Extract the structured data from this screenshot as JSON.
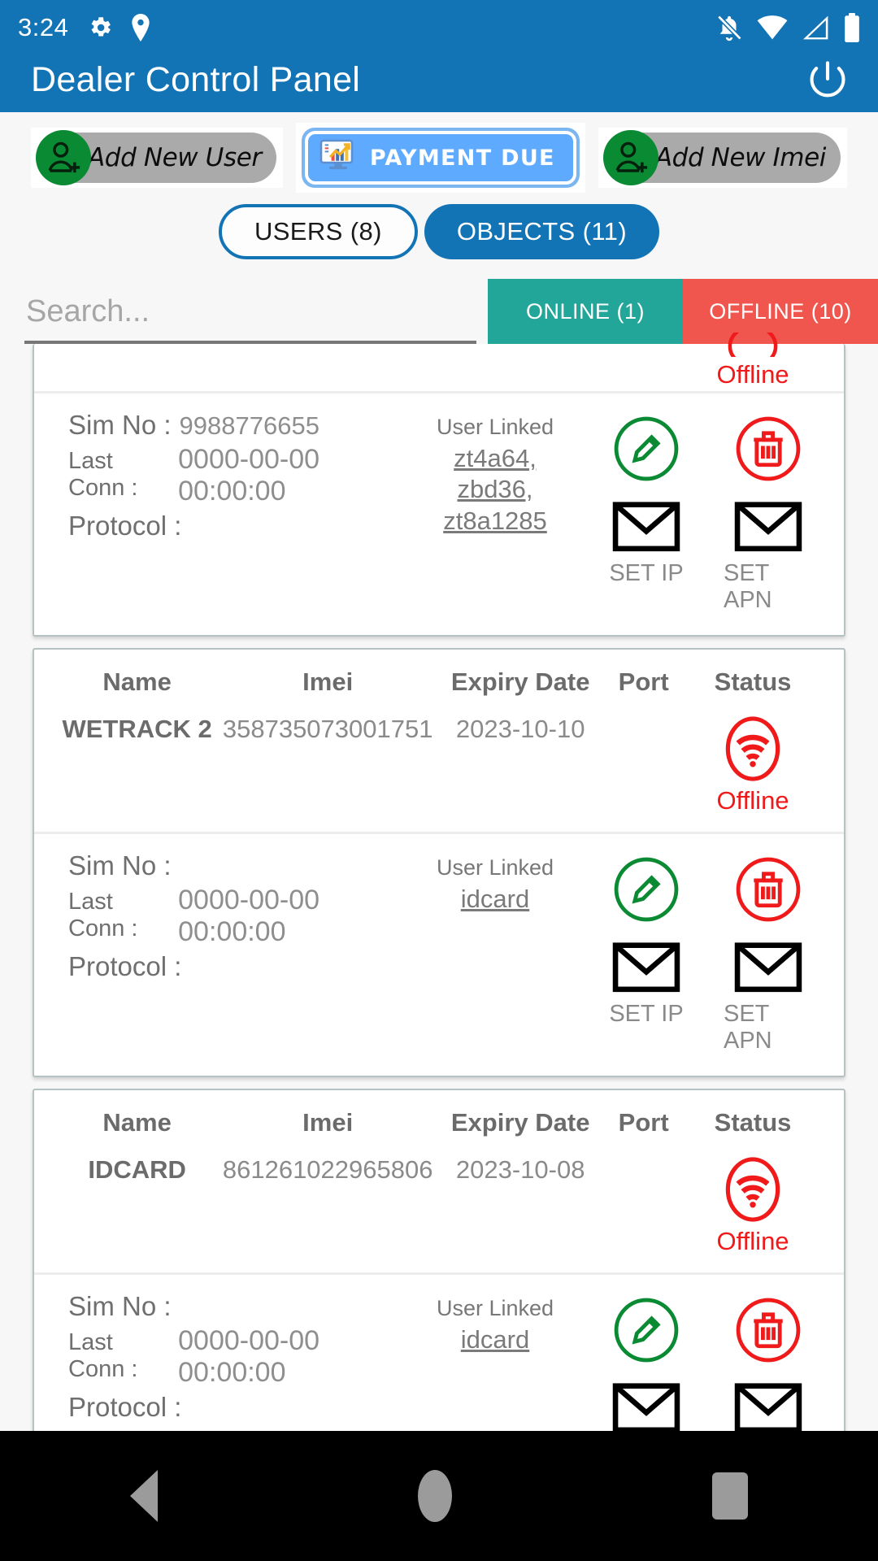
{
  "status_bar": {
    "time": "3:24",
    "left_icons": [
      "gear-icon",
      "location-pin-icon"
    ],
    "right_icons": [
      "notifications-off-icon",
      "wifi-icon",
      "signal-icon",
      "battery-icon"
    ]
  },
  "app_bar": {
    "title": "Dealer Control Panel",
    "power_icon": "power-icon"
  },
  "actions": {
    "add_user_label": "Add New User",
    "payment_due_label": "PAYMENT DUE",
    "add_imei_label": "Add  New Imei"
  },
  "tabs": {
    "users_label": "USERS (8)",
    "objects_label": "OBJECTS (11)",
    "selected": "OBJECTS (11)"
  },
  "search": {
    "value": "",
    "placeholder": "Search..."
  },
  "filters": {
    "online_label": "ONLINE (1)",
    "offline_label": "OFFLINE (10)"
  },
  "table_headers": {
    "name": "Name",
    "imei": "Imei",
    "expiry": "Expiry Date",
    "port": "Port",
    "status": "Status"
  },
  "detail_labels": {
    "sim_no": "Sim No :",
    "last_conn": "Last Conn :",
    "protocol": "Protocol :",
    "user_linked": "User Linked",
    "set_ip": "SET IP",
    "set_apn": "SET APN"
  },
  "cards": [
    {
      "clipped": true,
      "status_text": "Offline",
      "sim_no": "9988776655",
      "last_conn": "0000-00-00 00:00:00",
      "protocol": "",
      "linked_users": [
        "zt4a64,",
        "zbd36,",
        "zt8a1285"
      ]
    },
    {
      "clipped": false,
      "name": "WETRACK 2",
      "imei": "358735073001751",
      "expiry": "2023-10-10",
      "port": "",
      "status_text": "Offline",
      "sim_no": "",
      "last_conn": "0000-00-00 00:00:00",
      "protocol": "",
      "linked_users": [
        "idcard"
      ]
    },
    {
      "clipped": false,
      "name": "IDCARD",
      "imei": "861261022965806",
      "expiry": "2023-10-08",
      "port": "",
      "status_text": "Offline",
      "sim_no": "",
      "last_conn": "0000-00-00 00:00:00",
      "protocol": "",
      "linked_users": [
        "idcard"
      ]
    }
  ],
  "nav_bar": {
    "back": "back-icon",
    "home": "home-icon",
    "recents": "recents-icon"
  },
  "colors": {
    "primary": "#1273b5",
    "online": "#22a699",
    "offline": "#f0554e",
    "offline_text": "#f01a1a",
    "edit_green": "#0a8a33",
    "delete_red": "#f01a1a",
    "pill_gray": "#aaaaaa",
    "payment_blue": "#5eaaff"
  }
}
